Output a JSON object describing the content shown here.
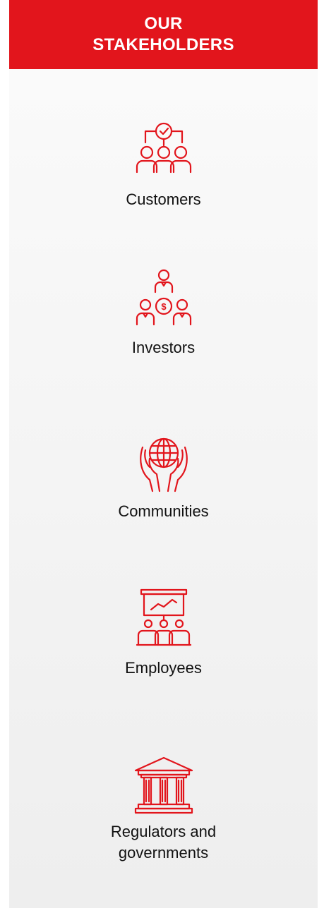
{
  "header": {
    "title": "OUR STAKEHOLDERS"
  },
  "stakeholders": [
    {
      "label": "Customers",
      "icon": "customers-icon"
    },
    {
      "label": "Investors",
      "icon": "investors-icon"
    },
    {
      "label": "Communities",
      "icon": "communities-icon"
    },
    {
      "label": "Employees",
      "icon": "employees-icon"
    },
    {
      "label": "Regulators and governments",
      "icon": "regulators-icon"
    }
  ],
  "colors": {
    "accent": "#e2151c",
    "text": "#111111",
    "background": "#f3f3f3"
  }
}
